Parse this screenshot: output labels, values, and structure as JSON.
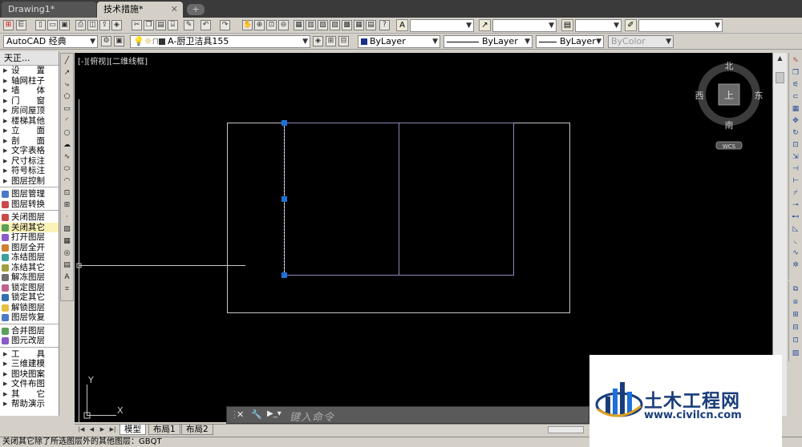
{
  "tabs": [
    {
      "label": "Drawing1*"
    },
    {
      "label": "技术措施*"
    }
  ],
  "close_glyph": "✕",
  "new_tab_glyph": "+",
  "toolbar": {
    "workspace": "AutoCAD 经典",
    "layer": "A-厨卫洁具155",
    "color": "ByLayer",
    "linetype": "ByLayer",
    "lineweight": "ByLayer",
    "plotstyle": "ByColor"
  },
  "menu": {
    "title": "天正...",
    "groups": [
      {
        "type": "tri",
        "items": [
          "设　　置",
          "轴网柱子",
          "墙　　体",
          "门　　窗",
          "房间屋顶",
          "楼梯其他",
          "立　　面",
          "剖　　面",
          "文字表格",
          "尺寸标注",
          "符号标注",
          "图层控制"
        ]
      },
      {
        "type": "layer",
        "items": [
          "图层管理",
          "图层转换"
        ]
      },
      {
        "type": "layer",
        "items": [
          "关闭图层",
          "关闭其它",
          "打开图层",
          "图层全开",
          "冻结图层",
          "冻结其它",
          "解冻图层",
          "锁定图层",
          "锁定其它",
          "解锁图层",
          "图层恢复"
        ]
      },
      {
        "type": "layer",
        "items": [
          "合并图层",
          "图元改层"
        ]
      },
      {
        "type": "tri",
        "items": [
          "工　　具",
          "三维建模",
          "图块图案",
          "文件布图",
          "其　　它",
          "帮助演示"
        ]
      }
    ]
  },
  "canvas": {
    "viewport_label": "[-][俯视][二维线框]",
    "compass": {
      "north": "北",
      "south": "南",
      "east": "东",
      "west": "西",
      "center": "上",
      "wcs": "WCS"
    },
    "ucs_x": "X",
    "ucs_y": "Y"
  },
  "command": {
    "placeholder": "键入命令",
    "close": "✕",
    "settings": "🔧",
    "prompt": "▶_▾"
  },
  "layout_tabs": [
    "模型",
    "布局1",
    "布局2"
  ],
  "status_text": "关闭其它除了所选图层外的其他图层：GBQT",
  "brand": {
    "name": "土木工程网",
    "url": "www.civilcn.com"
  },
  "colors": {
    "canvas_bg": "#000000",
    "grip_blue": "#1e6fd9",
    "brand_blue": "#1a3d7a",
    "highlight": "#fbf2b8"
  }
}
